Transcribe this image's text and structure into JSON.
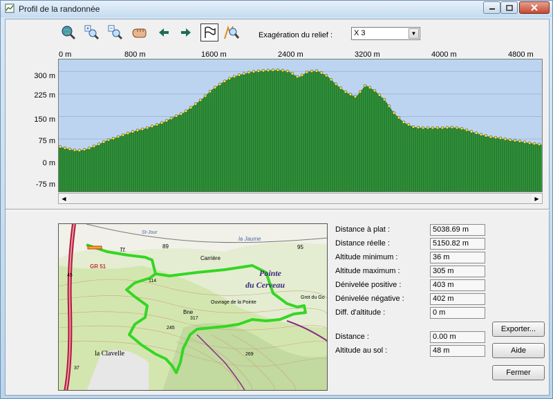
{
  "window": {
    "title": "Profil de la randonnée"
  },
  "toolbar": {
    "tools": [
      "zoom-globe-icon",
      "zoom-in-icon",
      "zoom-out-icon",
      "pan-hand-icon",
      "arrow-left-icon",
      "arrow-right-icon",
      "flag-select-icon",
      "zoom-route-icon"
    ],
    "exaggeration_label": "Exagération du relief :",
    "exaggeration_value": "X 3"
  },
  "chart_data": {
    "type": "area",
    "title": "",
    "x_ticks": [
      "0 m",
      "800 m",
      "1600 m",
      "2400 m",
      "3200 m",
      "4000 m",
      "4800 m"
    ],
    "y_ticks": [
      "300 m",
      "225 m",
      "150 m",
      "75 m",
      "0 m",
      "-75 m"
    ],
    "xlim": [
      0,
      5038.69
    ],
    "ylim": [
      -100,
      340
    ],
    "x": [
      0,
      100,
      200,
      300,
      400,
      500,
      600,
      700,
      800,
      900,
      1000,
      1100,
      1200,
      1300,
      1400,
      1500,
      1600,
      1700,
      1800,
      1900,
      2000,
      2100,
      2200,
      2300,
      2400,
      2500,
      2600,
      2700,
      2800,
      2900,
      3000,
      3100,
      3200,
      3250,
      3300,
      3400,
      3500,
      3600,
      3700,
      3800,
      3900,
      4000,
      4100,
      4200,
      4300,
      4400,
      4500,
      4600,
      4700,
      4800,
      4900,
      5038
    ],
    "y": [
      50,
      42,
      36,
      42,
      55,
      70,
      80,
      92,
      102,
      110,
      120,
      132,
      148,
      162,
      185,
      210,
      240,
      262,
      280,
      290,
      298,
      302,
      304,
      305,
      300,
      280,
      300,
      302,
      285,
      255,
      230,
      215,
      255,
      245,
      235,
      205,
      160,
      130,
      115,
      112,
      112,
      112,
      114,
      110,
      100,
      90,
      82,
      78,
      72,
      68,
      62,
      56
    ],
    "fill_color": "#2f9a3a",
    "line_color": "#1a1a1a",
    "marker_color": "#f2e33a",
    "background": "#bcd4f0",
    "grid": true
  },
  "stats": [
    {
      "label": "Distance à plat :",
      "value": "5038.69 m"
    },
    {
      "label": "Distance réelle :",
      "value": "5150.82 m"
    },
    {
      "label": "Altitude minimum :",
      "value": "36 m"
    },
    {
      "label": "Altitude maximum :",
      "value": "305 m"
    },
    {
      "label": "Dénivelée positive :",
      "value": "403 m"
    },
    {
      "label": "Dénivelée négative :",
      "value": "402 m"
    },
    {
      "label": "Diff. d'altitude :",
      "value": "0 m"
    }
  ],
  "cursor": [
    {
      "label": "Distance :",
      "value": "0.00 m"
    },
    {
      "label": "Altitude au sol :",
      "value": "48 m"
    }
  ],
  "buttons": {
    "export": "Exporter...",
    "help": "Aide",
    "close": "Fermer"
  },
  "map": {
    "labels": [
      "Carrière",
      "Pointe",
      "du Cerveau",
      "Ouvrage de la Pointe",
      "la Clavelle",
      "GR 51",
      "Tf.",
      "89",
      "95",
      "114",
      "245",
      "269",
      "317",
      "Bne",
      "Grot du Go",
      "la Jaume",
      "St-Jour",
      "45",
      "37"
    ]
  }
}
